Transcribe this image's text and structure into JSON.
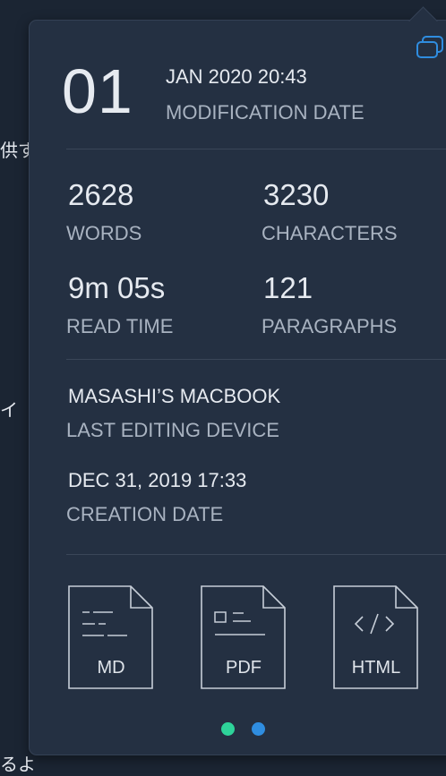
{
  "background": {
    "fragments": [
      "供す",
      "イ",
      "るよ"
    ]
  },
  "modification": {
    "day": "01",
    "month_year_time": "JAN 2020 20:43",
    "label": "MODIFICATION DATE"
  },
  "stats": {
    "words": {
      "value": "2628",
      "label": "WORDS"
    },
    "characters": {
      "value": "3230",
      "label": "CHARACTERS"
    },
    "read_time": {
      "value": "9m 05s",
      "label": "READ TIME"
    },
    "paragraphs": {
      "value": "121",
      "label": "PARAGRAPHS"
    }
  },
  "device": {
    "value": "MASASHI’S MACBOOK",
    "label": "LAST EDITING DEVICE"
  },
  "creation": {
    "value": "DEC 31, 2019 17:33",
    "label": "CREATION DATE"
  },
  "exports": [
    {
      "label": "MD",
      "icon": "markdown-file-icon"
    },
    {
      "label": "PDF",
      "icon": "pdf-file-icon"
    },
    {
      "label": "HTML",
      "icon": "html-file-icon"
    }
  ],
  "pagination": {
    "pages": 2,
    "active_page": 1,
    "colors": [
      "#2ed39a",
      "#2f8de0"
    ]
  },
  "colors": {
    "popover_bg": "#243042",
    "accent_blue": "#2f8de0",
    "text_primary": "#e6eaf0",
    "text_secondary": "#a9b3c1"
  }
}
